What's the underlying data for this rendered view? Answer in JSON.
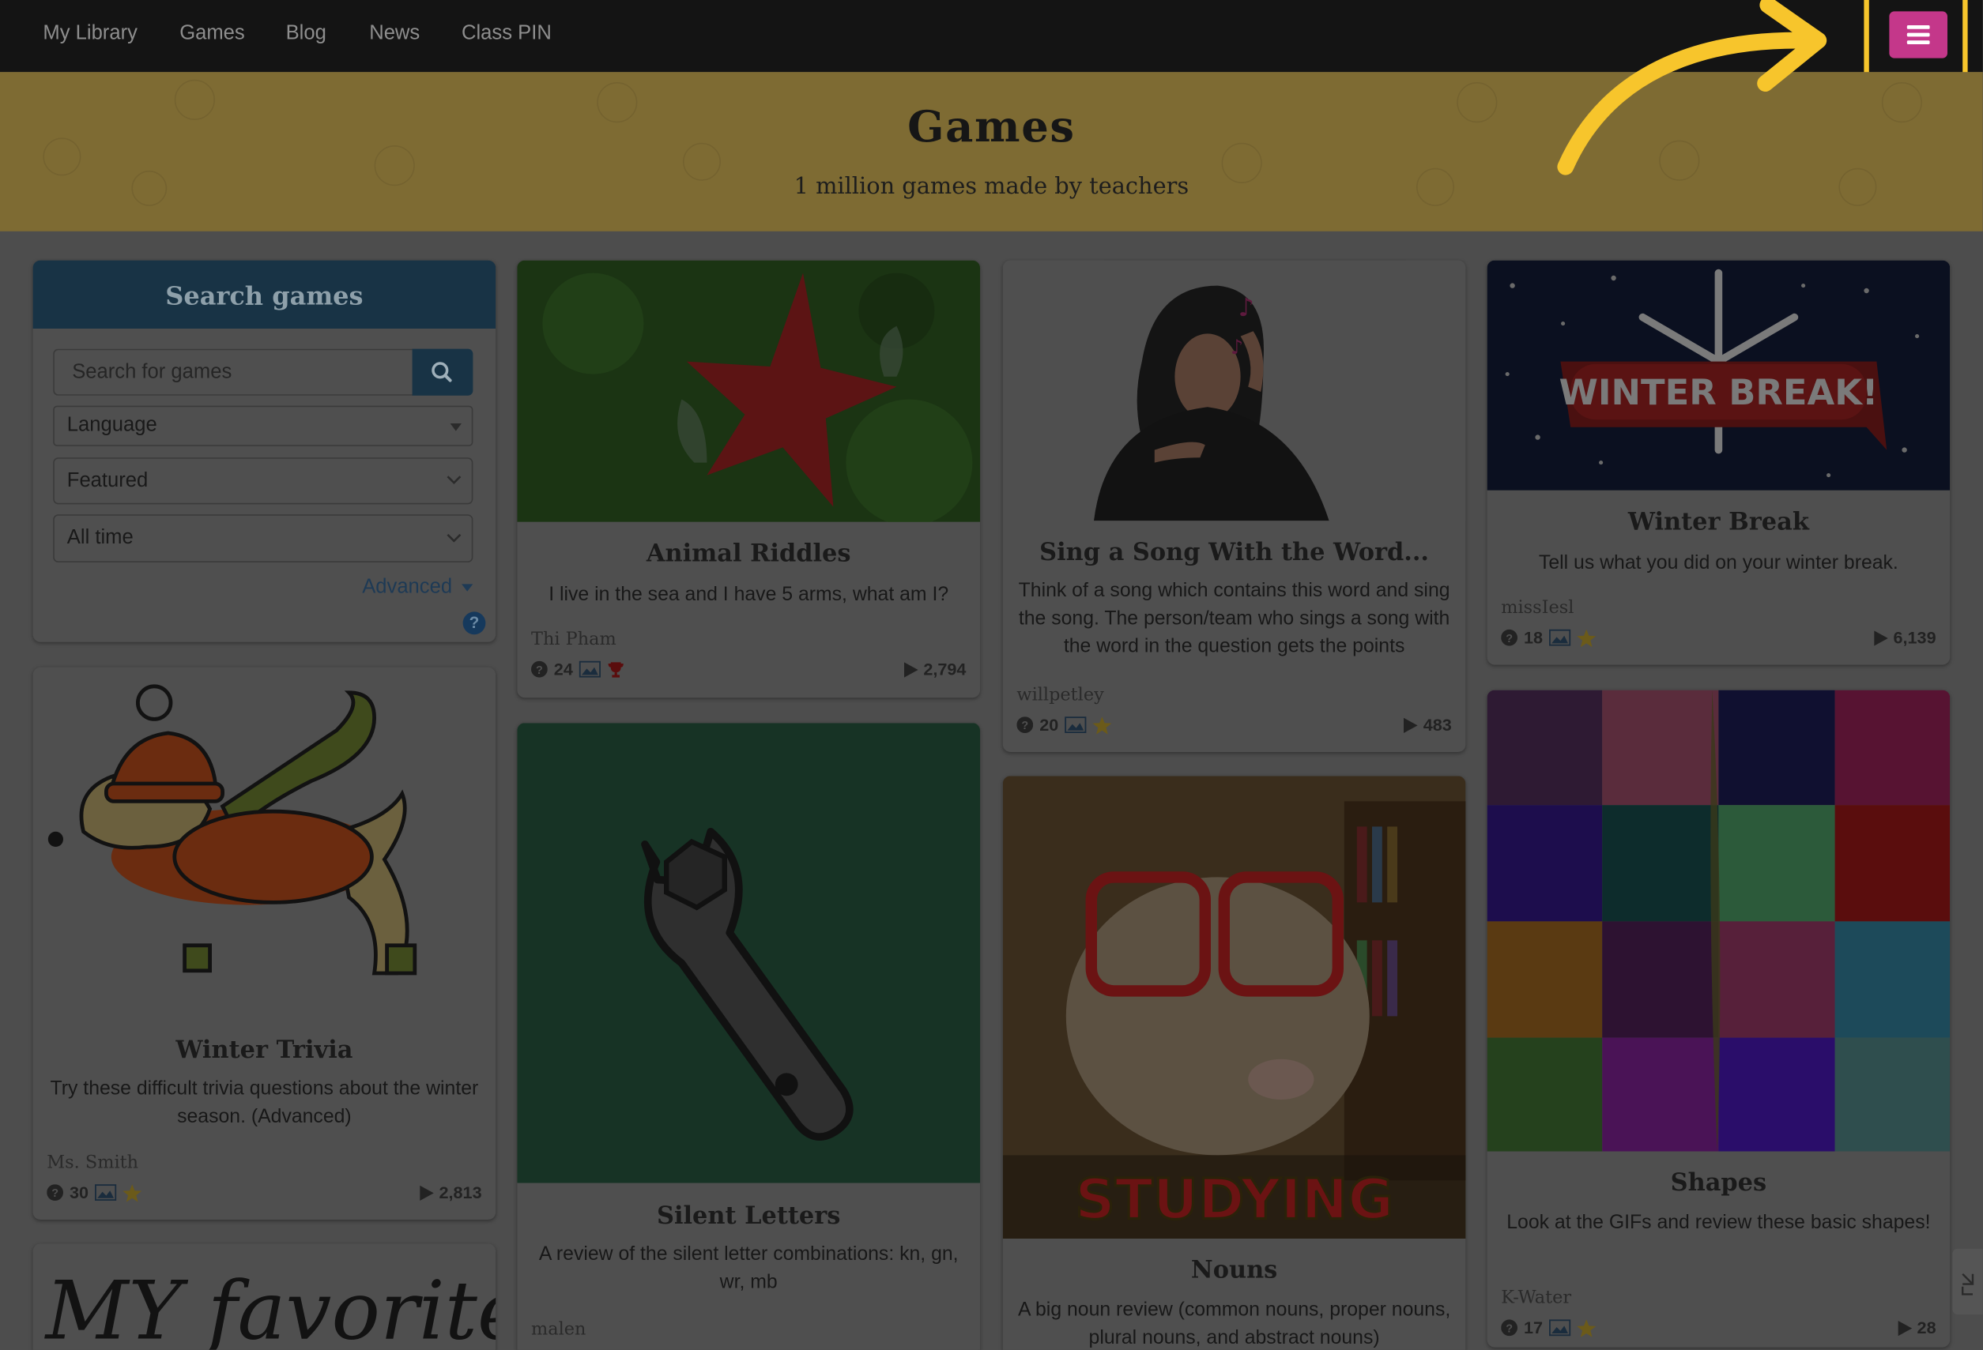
{
  "nav": {
    "links": [
      "My Library",
      "Games",
      "Blog",
      "News",
      "Class PIN"
    ],
    "menu_icon": "hamburger-menu-icon",
    "accent_color": "#c4378a",
    "highlight_color": "#f7c52c"
  },
  "hero": {
    "title": "Games",
    "subtitle": "1 million games made by teachers"
  },
  "search": {
    "title": "Search games",
    "placeholder": "Search for games",
    "language_label": "Language",
    "sort_label": "Featured",
    "time_label": "All time",
    "advanced_label": "Advanced",
    "help_label": "?"
  },
  "games": [
    {
      "title": "Winter Trivia",
      "description": "Try these difficult trivia questions about the winter season. (Advanced)",
      "author": "Ms. Smith",
      "questions": "30",
      "plays": "2,813"
    },
    {
      "title": "Animal Riddles",
      "description": "I live in the sea and I have 5 arms, what am I?",
      "author": "Thi Pham",
      "questions": "24",
      "plays": "2,794"
    },
    {
      "title": "Silent Letters",
      "description": "A review of the silent letter combinations: kn, gn, wr, mb",
      "author": "malen"
    },
    {
      "title": "Sing a Song With the Word...",
      "description": "Think of a song which contains this word and sing the song. The person/team who sings a song with the word in the question gets the points",
      "author": "willpetley",
      "questions": "20",
      "plays": "483"
    },
    {
      "title": "Nouns",
      "description": "A big noun review (common nouns, proper nouns, plural nouns, and abstract nouns)"
    },
    {
      "title": "Winter Break",
      "description": "Tell us what you did on your winter break.",
      "author": "missIesl",
      "questions": "18",
      "plays": "6,139"
    },
    {
      "title": "Shapes",
      "description": "Look at the GIFs and review these basic shapes!",
      "author": "K-Water",
      "questions": "17",
      "plays": "28"
    }
  ],
  "image_text": {
    "winter_break_banner": "WINTER BREAK!",
    "studying_caption": "STUDYING",
    "my_favorite": "MY favorite"
  }
}
